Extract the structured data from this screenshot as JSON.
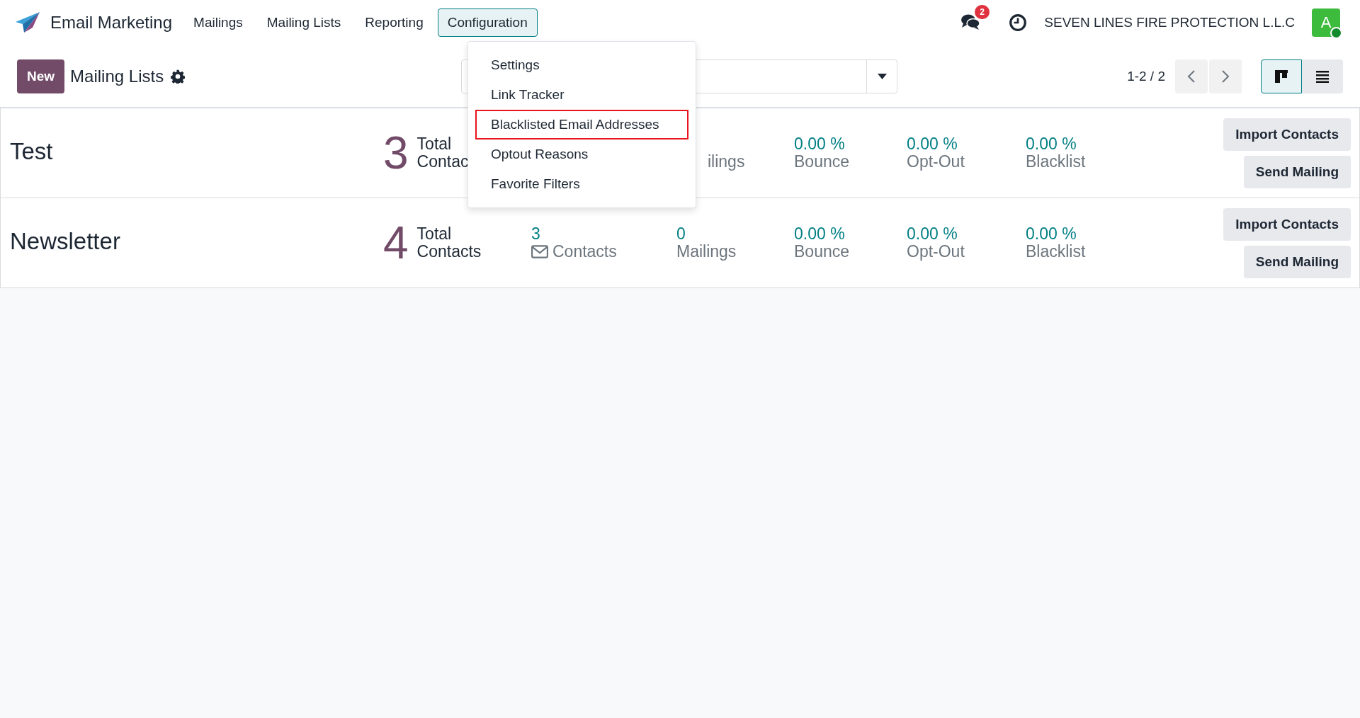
{
  "app": {
    "title": "Email Marketing"
  },
  "menu": [
    {
      "label": "Mailings",
      "selected": false
    },
    {
      "label": "Mailing Lists",
      "selected": false
    },
    {
      "label": "Reporting",
      "selected": false
    },
    {
      "label": "Configuration",
      "selected": true
    }
  ],
  "dropdown": [
    {
      "label": "Settings",
      "highlighted": false
    },
    {
      "label": "Link Tracker",
      "highlighted": false
    },
    {
      "label": "Blacklisted Email Addresses",
      "highlighted": true
    },
    {
      "label": "Optout Reasons",
      "highlighted": false
    },
    {
      "label": "Favorite Filters",
      "highlighted": false
    }
  ],
  "systray": {
    "chat_badge": "2",
    "company": "SEVEN LINES FIRE PROTECTION L.L.C",
    "avatar": "A"
  },
  "control": {
    "new_button": "New",
    "title": "Mailing Lists",
    "pager": "1-2 / 2",
    "views": [
      {
        "kind": "kanban",
        "selected": true
      },
      {
        "kind": "list",
        "selected": false
      }
    ]
  },
  "rows": [
    {
      "name": "Test",
      "total": {
        "value": "3",
        "label": "Total Contac"
      },
      "stats": [
        {
          "kind": "mailings",
          "label": "ilings"
        },
        {
          "kind": "bounce",
          "value": "0.00 %",
          "label": "Bounce"
        },
        {
          "kind": "optout",
          "value": "0.00 %",
          "label": "Opt-Out"
        },
        {
          "kind": "blacklist",
          "value": "0.00 %",
          "label": "Blacklist"
        }
      ],
      "buttons": [
        "Import Contacts",
        "Send Mailing"
      ]
    },
    {
      "name": "Newsletter",
      "total": {
        "value": "4",
        "label": "Total Contacts"
      },
      "stats": [
        {
          "kind": "contacts",
          "value": "3",
          "label": "Contacts"
        },
        {
          "kind": "mailings",
          "value": "0",
          "label": "Mailings"
        },
        {
          "kind": "bounce",
          "value": "0.00 %",
          "label": "Bounce"
        },
        {
          "kind": "optout",
          "value": "0.00 %",
          "label": "Opt-Out"
        },
        {
          "kind": "blacklist",
          "value": "0.00 %",
          "label": "Blacklist"
        }
      ],
      "buttons": [
        "Import Contacts",
        "Send Mailing"
      ]
    }
  ]
}
